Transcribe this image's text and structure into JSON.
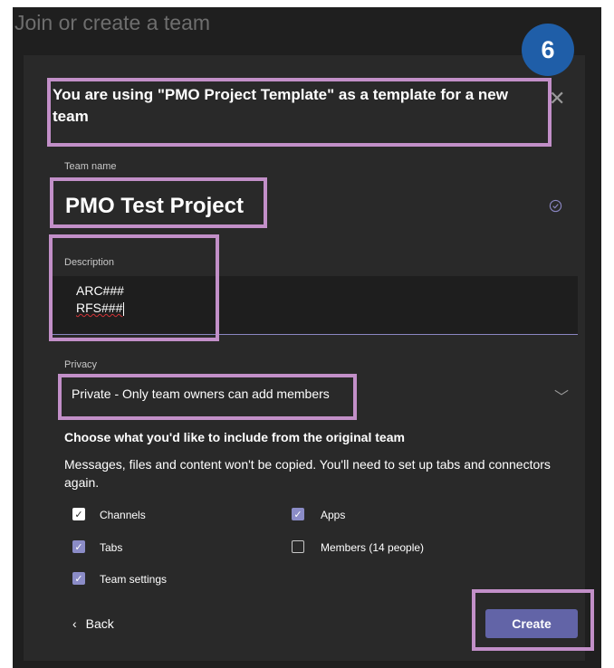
{
  "background_title": "Join or create a team",
  "step_badge": "6",
  "dialog": {
    "heading": "You are using \"PMO Project Template\" as a template for a new team",
    "team_name_label": "Team name",
    "team_name_value": "PMO Test Project",
    "description_label": "Description",
    "description_lines": [
      "ARC###",
      "RFS###"
    ],
    "privacy_label": "Privacy",
    "privacy_value": "Private - Only team owners can add members",
    "include_title": "Choose what you'd like to include from the original team",
    "include_text": "Messages, files and content won't be copied. You'll need to set up tabs and connectors again.",
    "options": [
      {
        "label": "Channels",
        "checked": true
      },
      {
        "label": "Apps",
        "checked": true
      },
      {
        "label": "Tabs",
        "checked": true
      },
      {
        "label": "Members (14 people)",
        "checked": false
      },
      {
        "label": "Team settings",
        "checked": true
      }
    ],
    "back_label": "Back",
    "create_label": "Create"
  },
  "colors": {
    "highlight": "#c28fc8",
    "accent": "#6264a7",
    "badge": "#1f5ea8"
  }
}
